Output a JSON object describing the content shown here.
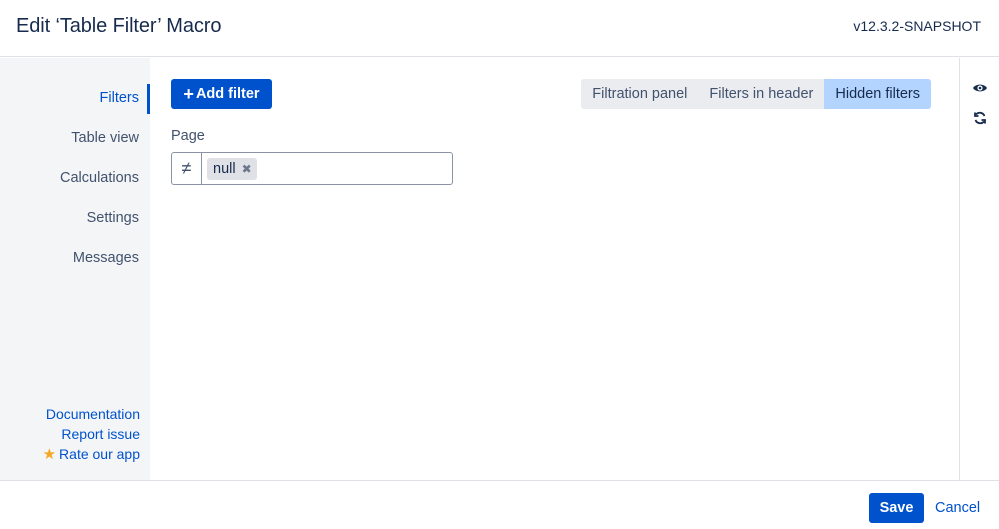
{
  "header": {
    "title": "Edit ‘Table Filter’ Macro",
    "version": "v12.3.2-SNAPSHOT"
  },
  "sidebar": {
    "items": [
      {
        "label": "Filters",
        "active": true
      },
      {
        "label": "Table view",
        "active": false
      },
      {
        "label": "Calculations",
        "active": false
      },
      {
        "label": "Settings",
        "active": false
      },
      {
        "label": "Messages",
        "active": false
      }
    ],
    "links": {
      "documentation": "Documentation",
      "report_issue": "Report issue",
      "rate_app": "Rate our app"
    }
  },
  "toolbar": {
    "add_filter_label": "Add filter",
    "view_modes": [
      {
        "label": "Filtration panel",
        "selected": false
      },
      {
        "label": "Filters in header",
        "selected": false
      },
      {
        "label": "Hidden filters",
        "selected": true
      }
    ]
  },
  "filter": {
    "field_label": "Page",
    "operator": "≠",
    "values": [
      "null"
    ]
  },
  "right_toolbar": {
    "icons": [
      "eye-icon",
      "refresh-icon"
    ]
  },
  "footer": {
    "save_label": "Save",
    "cancel_label": "Cancel"
  },
  "colors": {
    "accent": "#0052cc",
    "selected_segment": "#b3d4ff",
    "sidebar_bg": "#f4f5f7",
    "star": "#f5a623"
  }
}
